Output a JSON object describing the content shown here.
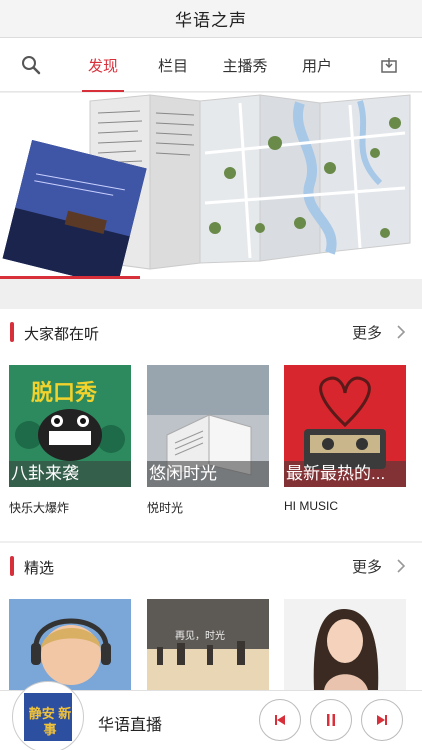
{
  "header": {
    "title": "华语之声"
  },
  "tabs": [
    {
      "label": "发现",
      "active": true
    },
    {
      "label": "栏目"
    },
    {
      "label": "主播秀"
    },
    {
      "label": "用户"
    }
  ],
  "icons": {
    "search": "search-icon",
    "download": "download-icon"
  },
  "sections": [
    {
      "title": "大家都在听",
      "more": "更多",
      "items": [
        {
          "caption": "八卦来袭",
          "name": "快乐大爆炸",
          "art_text": "脱口秀"
        },
        {
          "caption": "悠闲时光",
          "name": "悦时光"
        },
        {
          "caption": "最新最热的...",
          "name": "HI MUSIC"
        }
      ]
    },
    {
      "title": "精选",
      "more": "更多",
      "items": [
        {
          "caption": "",
          "name": ""
        },
        {
          "caption": "",
          "name": "",
          "art_text": "再见，时光"
        },
        {
          "caption": "",
          "name": ""
        }
      ]
    }
  ],
  "player": {
    "station": "华语直播",
    "logo_text": "静安 新事"
  },
  "colors": {
    "accent": "#d8303b"
  }
}
